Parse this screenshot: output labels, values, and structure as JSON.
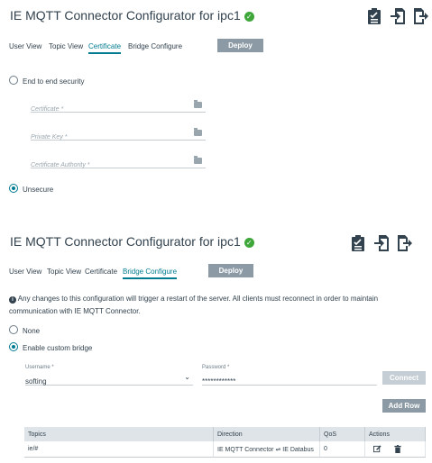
{
  "panel1": {
    "title": "IE MQTT Connector Configurator for ipc1",
    "tabs": [
      "User View",
      "Topic View",
      "Certificate",
      "Bridge Configure"
    ],
    "active_tab": "Certificate",
    "deploy_label": "Deploy",
    "options": {
      "end_to_end": "End to end security",
      "unsecure": "Unsecure"
    },
    "fields": {
      "certificate": "Certificate *",
      "private_key": "Private Key *",
      "certificate_authority": "Certificate Authority *"
    }
  },
  "panel2": {
    "title": "IE MQTT Connector Configurator for ipc1",
    "tabs": [
      "User View",
      "Topic View",
      "Certificate",
      "Bridge Configure"
    ],
    "active_tab": "Bridge Configure",
    "deploy_label": "Deploy",
    "info_line1": "Any changes to this configuration will trigger a restart of the server. All clients must reconnect in order to maintain",
    "info_line2": "communication with IE MQTT Connector.",
    "options": {
      "none": "None",
      "custom": "Enable custom bridge"
    },
    "username_label": "Username *",
    "username_value": "softing",
    "password_label": "Password *",
    "password_value": "************",
    "connect_label": "Connect",
    "add_row_label": "Add Row",
    "table": {
      "headers": [
        "Topics",
        "Direction",
        "QoS",
        "Actions"
      ],
      "rows": [
        {
          "topic": "ie/#",
          "direction_from": "IE MQTT Connector",
          "direction_arrow": "⇌",
          "direction_to": "IE Databus",
          "qos": "0"
        }
      ]
    }
  },
  "colors": {
    "accent": "#007b8f",
    "button": "#8b9aa5",
    "ok_green": "#3fa63a"
  },
  "icons": [
    "clipboard-check-icon",
    "import-icon",
    "export-icon",
    "folder-icon",
    "info-icon",
    "edit-icon",
    "trash-icon"
  ]
}
